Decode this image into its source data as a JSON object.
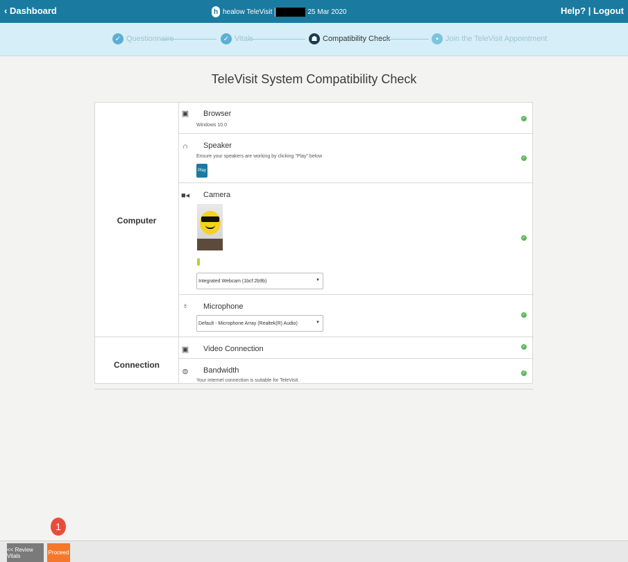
{
  "header": {
    "back_label": "Dashboard",
    "brand_logo": "h",
    "brand_name": "healow TeleVisit",
    "date": "25 Mar 2020",
    "help_label": "Help?",
    "logout_label": "Logout"
  },
  "stepper": {
    "steps": [
      {
        "label": "Questionnaire",
        "state": "done"
      },
      {
        "label": "Vitals",
        "state": "done"
      },
      {
        "label": "Compatibility Check",
        "state": "active"
      },
      {
        "label": "Join the TeleVisit Appointment",
        "state": "future"
      }
    ]
  },
  "page": {
    "title": "TeleVisit System Compatibility Check"
  },
  "sections": {
    "computer_label": "Computer",
    "connection_label": "Connection"
  },
  "rows": {
    "browser": {
      "title": "Browser",
      "sub": "Windows 10.0"
    },
    "speaker": {
      "title": "Speaker",
      "sub": "Ensure your speakers are working by clicking \"Play\" below",
      "button": "Play"
    },
    "camera": {
      "title": "Camera",
      "device": "Integrated Webcam (1bcf:2b9b)"
    },
    "microphone": {
      "title": "Microphone",
      "device": "Default - Microphone Array (Realtek(R) Audio)"
    },
    "video": {
      "title": "Video Connection"
    },
    "bandwidth": {
      "title": "Bandwidth",
      "sub": "Your internet connection is suitable for TeleVisit."
    }
  },
  "footer": {
    "review_label": "<< Review Vitals",
    "proceed_label": "Proceed",
    "badge": "1"
  },
  "colors": {
    "header": "#1a7aa0",
    "stepper_bg": "#d6eef7",
    "check": "#5cb85c",
    "proceed": "#f5782a",
    "badge": "#ea4c3b"
  }
}
